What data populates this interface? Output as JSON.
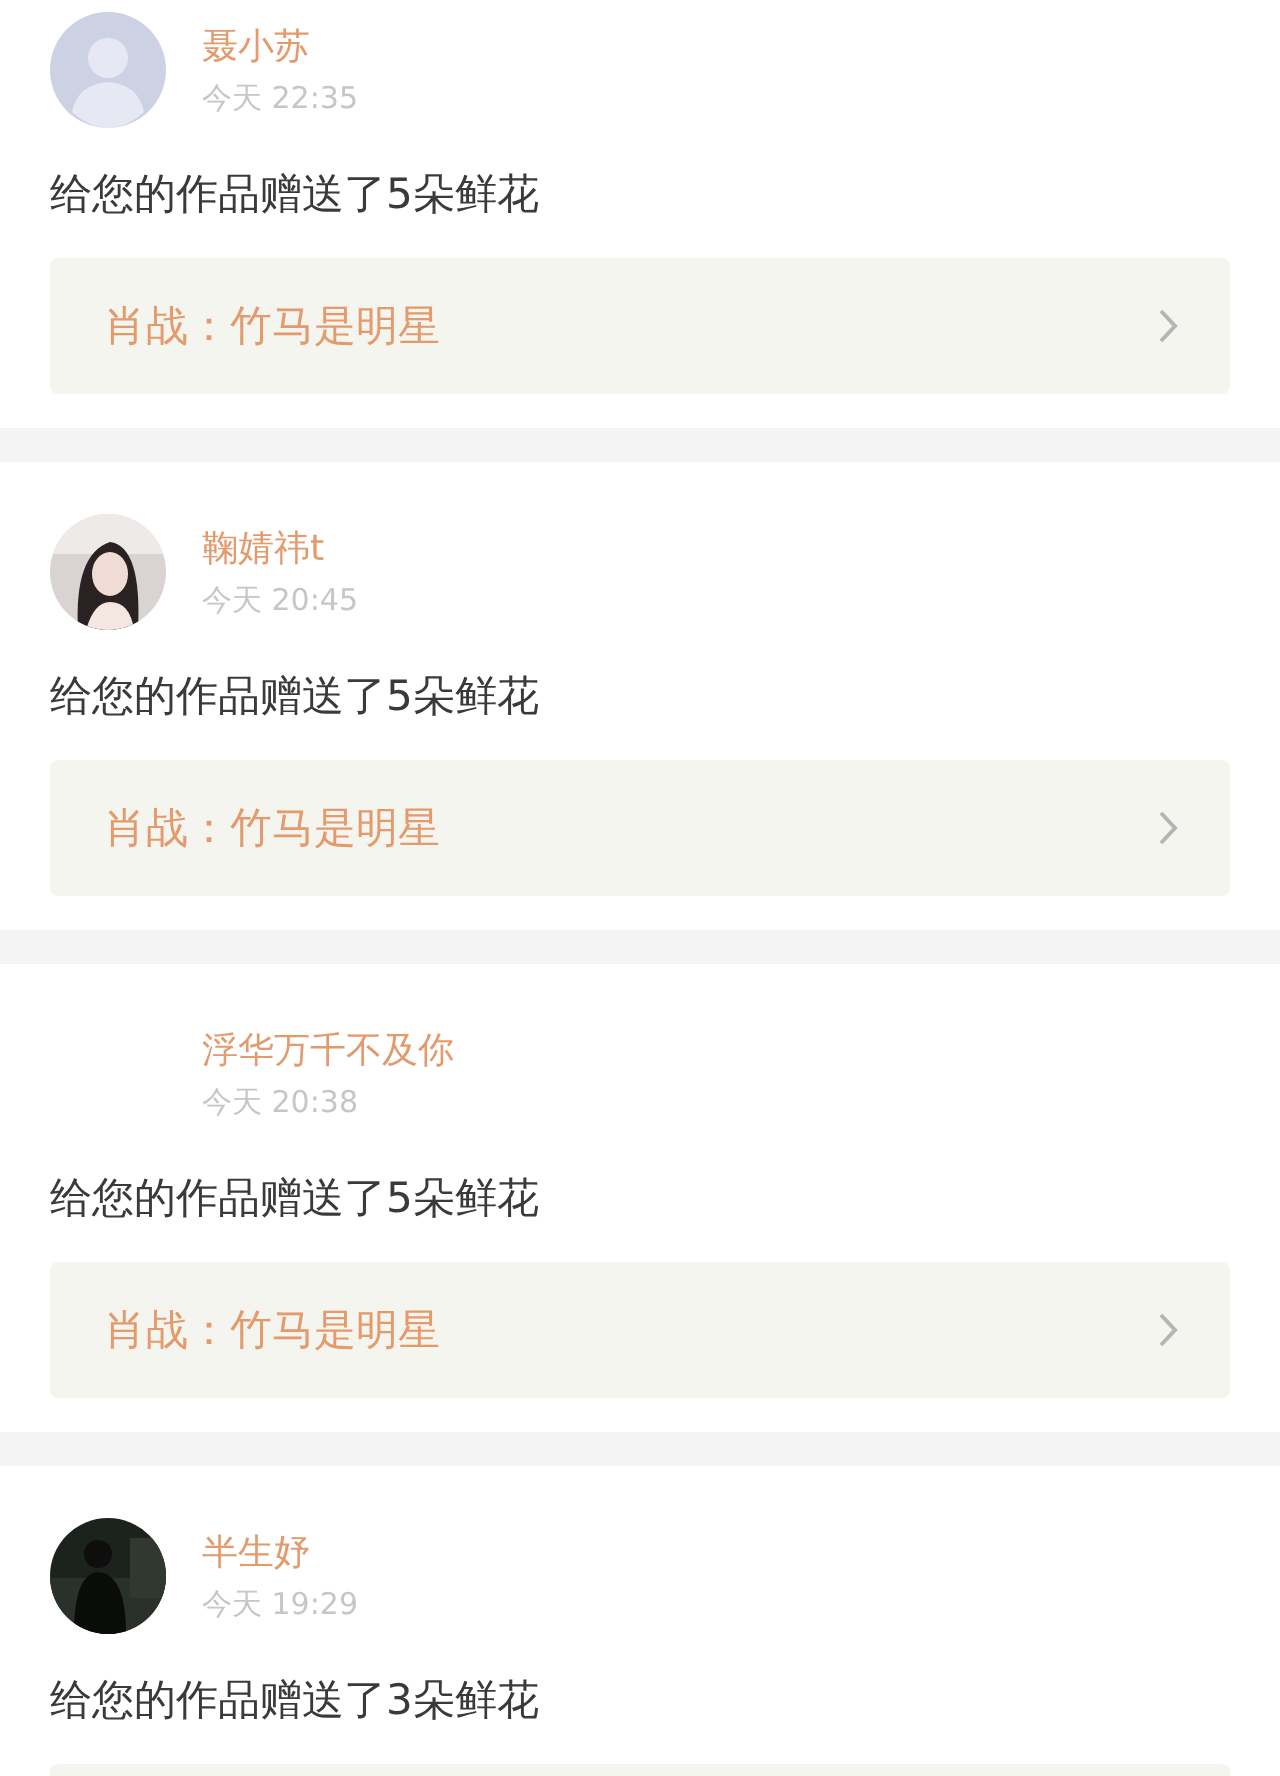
{
  "notifications": [
    {
      "avatar": {
        "kind": "default"
      },
      "name": "聂小苏",
      "time": "今天 22:35",
      "message": "给您的作品赠送了5朵鲜花",
      "attachment": {
        "kind": "link",
        "title": "肖战：竹马是明星"
      }
    },
    {
      "name": "鞠婧祎t",
      "time": "今天 20:45",
      "message": "给您的作品赠送了5朵鲜花",
      "attachment": {
        "kind": "link",
        "title": "肖战：竹马是明星"
      }
    },
    {
      "avatar": {
        "kind": "none"
      },
      "name": "浮华万千不及你",
      "time": "今天 20:38",
      "message": "给您的作品赠送了5朵鲜花",
      "attachment": {
        "kind": "link",
        "title": "肖战：竹马是明星"
      }
    },
    {
      "avatar": {
        "kind": "dark-picture"
      },
      "name": "半生妤",
      "time": "今天 19:29",
      "message": "给您的作品赠送了3朵鲜花",
      "attachment": {
        "kind": "cut"
      }
    }
  ]
}
